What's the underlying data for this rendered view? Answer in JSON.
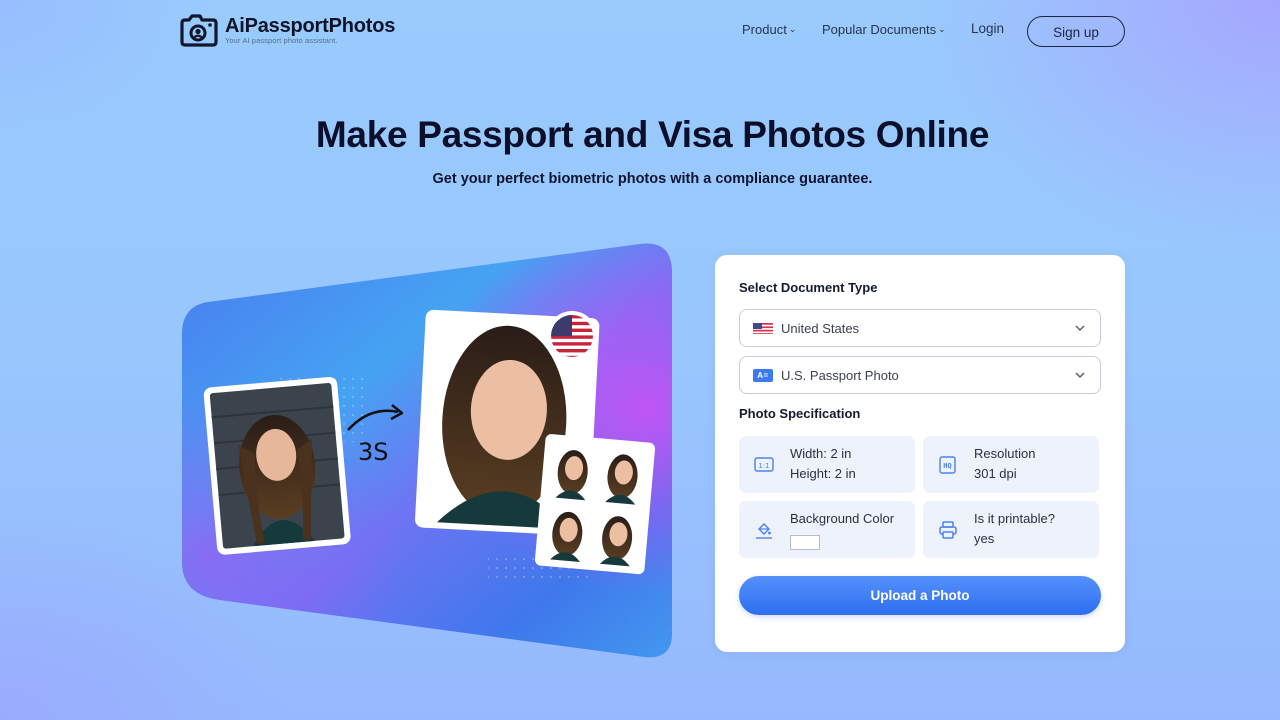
{
  "brand": {
    "name": "AiPassportPhotos",
    "tagline": "Your AI passport photo assistant."
  },
  "nav": {
    "items": [
      {
        "label": "Product",
        "has_dropdown": true
      },
      {
        "label": "Popular Documents",
        "has_dropdown": true
      }
    ],
    "login_label": "Login",
    "signup_label": "Sign up",
    "dropdown_glyph": "⌄"
  },
  "hero": {
    "title": "Make Passport and Visa Photos Online",
    "subtitle": "Get your perfect biometric photos with a compliance guarantee."
  },
  "illustration": {
    "processing_time_label": "3S",
    "flag": "united-states"
  },
  "form": {
    "document_type_label": "Select Document Type",
    "country_select": {
      "value": "United States"
    },
    "document_select": {
      "value": "U.S. Passport Photo",
      "icon_text": "A="
    },
    "spec_label": "Photo Specification",
    "specs": {
      "size": {
        "line1": "Width: 2 in",
        "line2": "Height: 2 in",
        "icon_text": "1:1"
      },
      "resolution": {
        "line1": "Resolution",
        "line2": "301 dpi",
        "icon_text": "HQ"
      },
      "background": {
        "line1": "Background Color",
        "color": "#ffffff"
      },
      "printable": {
        "line1": "Is it printable?",
        "line2": "yes"
      }
    },
    "upload_label": "Upload a Photo"
  },
  "colors": {
    "accent": "#2e6ef0",
    "tile_bg": "#eef2fd",
    "heading": "#0b0f2a"
  }
}
